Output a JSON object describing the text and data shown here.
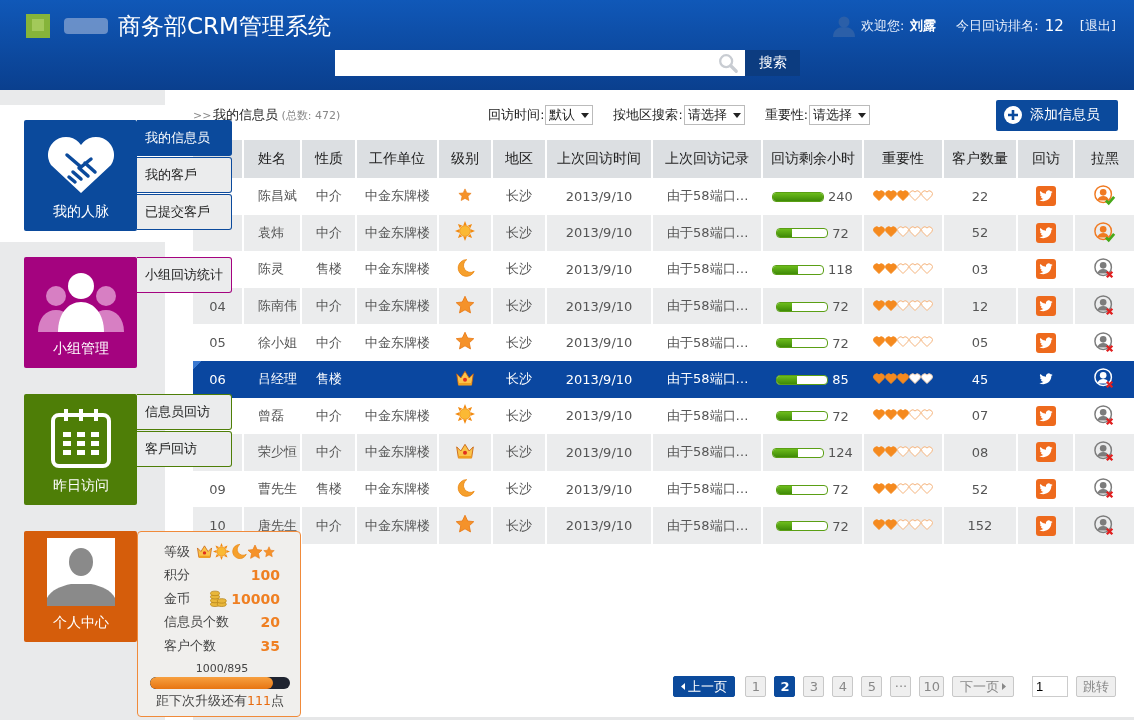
{
  "header": {
    "title": "商务部CRM管理系统",
    "welcome": "欢迎您:",
    "user": "刘露",
    "rank_label": "今日回访排名:",
    "rank": "12",
    "logout": "[退出]",
    "search": {
      "button": "搜索"
    }
  },
  "nav": [
    {
      "label": "我的人脉",
      "kind": "handshake",
      "color": "#0b4a9c",
      "selected": true,
      "submenu": [
        {
          "label": "我的信息员",
          "selected": true
        },
        {
          "label": "我的客戶",
          "selected": false
        },
        {
          "label": "已提交客戶",
          "selected": false
        }
      ]
    },
    {
      "label": "小组管理",
      "kind": "group",
      "color": "#a4037f",
      "selected": false,
      "submenu": [
        {
          "label": "小组回访统计",
          "selected": false
        }
      ]
    },
    {
      "label": "昨日访问",
      "kind": "calendar",
      "color": "#4e7e07",
      "selected": false,
      "submenu": [
        {
          "label": "信息员回访",
          "selected": false
        },
        {
          "label": "客戶回访",
          "selected": false
        }
      ]
    },
    {
      "label": "个人中心",
      "kind": "avatar",
      "color": "#d55d0b",
      "selected": false
    }
  ],
  "profile": {
    "stats": [
      {
        "label": "等级",
        "kind": "badges",
        "badges": [
          {
            "kind": "crown"
          },
          {
            "kind": "sun"
          },
          {
            "kind": "moon"
          },
          {
            "kind": "star"
          },
          {
            "kind": "star_small"
          }
        ]
      },
      {
        "label": "积分",
        "kind": "value",
        "value": "100"
      },
      {
        "label": "金币",
        "kind": "coins",
        "value": "10000"
      },
      {
        "label": "信息员个数",
        "kind": "value",
        "value": "20"
      },
      {
        "label": "客户个数",
        "kind": "value",
        "value": "35"
      }
    ],
    "progress_text": "1000/895",
    "level": 0.88,
    "footer": "距下次升级还有**111**点"
  },
  "toolbar": {
    "breadcrumb_mark": ">>",
    "breadcrumb": "我的信息员",
    "total": "(总数: 472)",
    "filters": [
      {
        "label": "回访时间:",
        "value": "默认"
      },
      {
        "label": "按地区搜索:",
        "value": "请选择"
      },
      {
        "label": "重要性:",
        "value": "请选择"
      }
    ],
    "add_button": "添加信息员"
  },
  "table": {
    "columns": [
      "姓名",
      "性质",
      "工作单位",
      "级别",
      "地区",
      "上次回访时间",
      "上次回访记录",
      "回访剩余小时",
      "重要性",
      "客户数量",
      "回访",
      "拉黑"
    ],
    "rows": [
      {
        "name": "陈昌斌",
        "type": "中介",
        "company": "中金东牌楼",
        "rank": {
          "kind": "star_small"
        },
        "region": "长沙",
        "last_time": "2013/9/10",
        "last_record": "由于58端口…",
        "level": 1.0,
        "hours": "240",
        "stars": 3,
        "customers": "22",
        "blocked": false,
        "selected": false
      },
      {
        "name": "袁炜",
        "type": "中介",
        "company": "中金东牌楼",
        "rank": {
          "kind": "sun"
        },
        "region": "长沙",
        "last_time": "2013/9/10",
        "last_record": "由于58端口…",
        "level": 0.3,
        "hours": "72",
        "stars": 2,
        "customers": "52",
        "blocked": false,
        "selected": false
      },
      {
        "name": "陈灵",
        "type": "售楼",
        "company": "中金东牌楼",
        "rank": {
          "kind": "moon"
        },
        "region": "长沙",
        "last_time": "2013/9/10",
        "last_record": "由于58端口…",
        "level": 0.5,
        "hours": "118",
        "stars": 2,
        "customers": "03",
        "blocked": true,
        "selected": false
      },
      {
        "no": "04",
        "name": "陈南伟",
        "type": "中介",
        "company": "中金东牌楼",
        "rank": {
          "kind": "star"
        },
        "region": "长沙",
        "last_time": "2013/9/10",
        "last_record": "由于58端口…",
        "level": 0.3,
        "hours": "72",
        "stars": 2,
        "customers": "12",
        "blocked": true,
        "selected": false
      },
      {
        "no": "05",
        "name": "徐小姐",
        "type": "中介",
        "company": "中金东牌楼",
        "rank": {
          "kind": "star"
        },
        "region": "长沙",
        "last_time": "2013/9/10",
        "last_record": "由于58端口…",
        "level": 0.3,
        "hours": "72",
        "stars": 2,
        "customers": "05",
        "blocked": true,
        "selected": false
      },
      {
        "no": "06",
        "name": "吕经理",
        "type": "售楼",
        "rank": {
          "kind": "crown"
        },
        "region": "长沙",
        "last_time": "2013/9/10",
        "last_record": "由于58端口…",
        "level": 0.4,
        "hours": "85",
        "stars": 3,
        "customers": "45",
        "blocked": true,
        "selected": true
      },
      {
        "name": "曾磊",
        "type": "中介",
        "company": "中金东牌楼",
        "rank": {
          "kind": "sun"
        },
        "region": "长沙",
        "last_time": "2013/9/10",
        "last_record": "由于58端口…",
        "level": 0.3,
        "hours": "72",
        "stars": 3,
        "customers": "07",
        "blocked": true,
        "selected": false
      },
      {
        "name": "荣少恒",
        "type": "中介",
        "company": "中金东牌楼",
        "rank": {
          "kind": "crown"
        },
        "region": "长沙",
        "last_time": "2013/9/10",
        "last_record": "由于58端口…",
        "level": 0.5,
        "hours": "124",
        "stars": 2,
        "customers": "08",
        "blocked": true,
        "selected": false
      },
      {
        "no": "09",
        "name": "曹先生",
        "type": "售楼",
        "company": "中金东牌楼",
        "rank": {
          "kind": "moon"
        },
        "region": "长沙",
        "last_time": "2013/9/10",
        "last_record": "由于58端口…",
        "level": 0.3,
        "hours": "72",
        "stars": 2,
        "customers": "52",
        "blocked": true,
        "selected": false
      },
      {
        "no": "10",
        "name": "唐先生",
        "type": "中介",
        "company": "中金东牌楼",
        "rank": {
          "kind": "star"
        },
        "region": "长沙",
        "last_time": "2013/9/10",
        "last_record": "由于58端口…",
        "level": 0.3,
        "hours": "72",
        "stars": 2,
        "customers": "152",
        "blocked": true,
        "selected": false
      }
    ]
  },
  "pager": {
    "prev": "上一页",
    "pages": [
      {
        "label": "1",
        "selected": false
      },
      {
        "label": "2",
        "selected": true
      },
      {
        "label": "3",
        "selected": false
      },
      {
        "label": "4",
        "selected": false
      },
      {
        "label": "5",
        "selected": false
      },
      {
        "label": "···",
        "selected": false
      },
      {
        "label": "10",
        "selected": false
      }
    ],
    "next": "下一页",
    "jump_value": "1",
    "jump_button": "跳转"
  }
}
